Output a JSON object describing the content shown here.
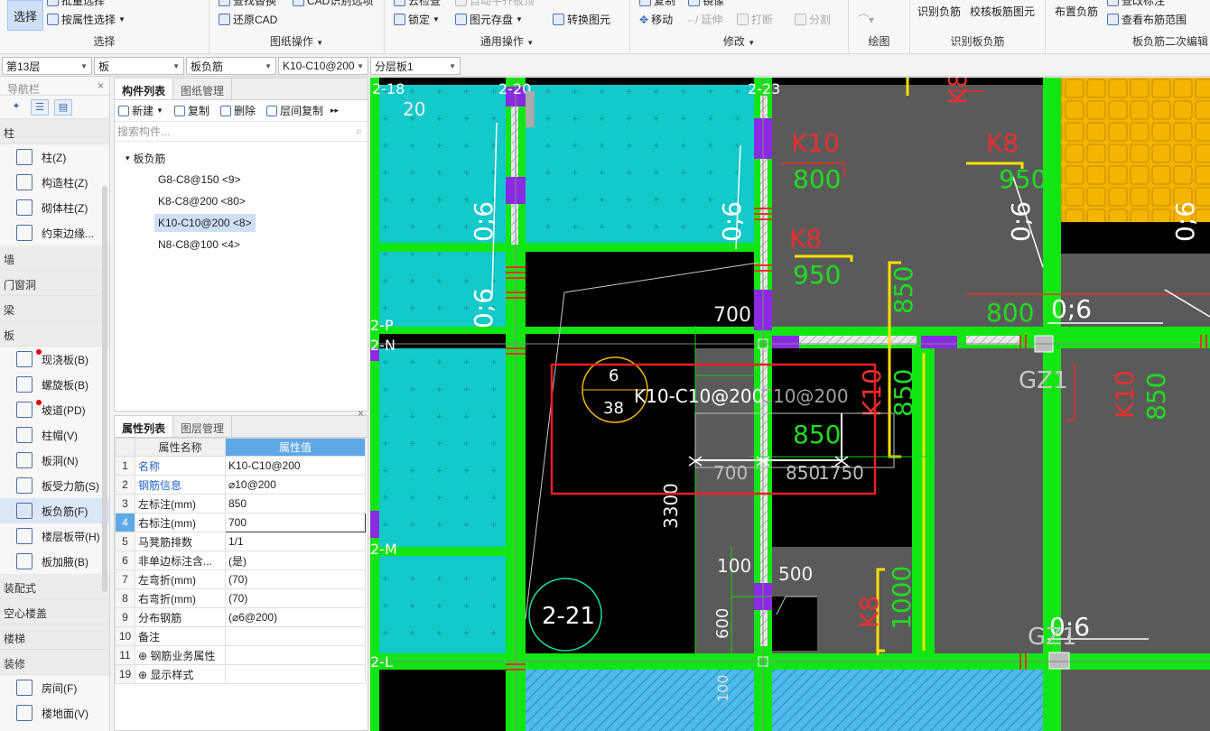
{
  "ribbon": {
    "select_button": "选择",
    "groups": [
      {
        "title": "选择",
        "items": [
          "批量选择",
          "按属性选择"
        ]
      },
      {
        "title": "图纸操作",
        "items": [
          "查找替换",
          "还原CAD",
          "CAD识别选项",
          "设置比例"
        ]
      },
      {
        "title": "通用操作",
        "items": [
          "锁定",
          "图元存盘",
          "转换图元",
          "云检查",
          "自动平齐板顶"
        ]
      },
      {
        "title": "修改",
        "items": [
          "移动",
          "延伸",
          "打断",
          "分割",
          "复制",
          "镜像"
        ]
      },
      {
        "title": "绘图",
        "items": []
      },
      {
        "title": "识别板负筋",
        "items": [
          "识别负筋",
          "校核板筋图元"
        ]
      },
      {
        "title": "板负筋二次编辑",
        "items": [
          "布置负筋",
          "查看布筋范围",
          "查改标注"
        ]
      }
    ]
  },
  "toolbar": {
    "floor": "第13层",
    "type": "板",
    "subtype": "板负筋",
    "component": "K10-C10@200",
    "layer": "分层板1"
  },
  "nav": {
    "title": "导航栏",
    "categories": [
      {
        "label": "柱",
        "items": [
          {
            "label": "柱(Z)",
            "icon": "column-icon",
            "dot": false
          },
          {
            "label": "构造柱(Z)",
            "icon": "constructional-column-icon",
            "dot": false
          },
          {
            "label": "砌体柱(Z)",
            "icon": "masonry-column-icon",
            "dot": false
          },
          {
            "label": "约束边缘...",
            "icon": "constraint-edge-icon",
            "dot": false
          }
        ]
      },
      {
        "label": "墙",
        "items": []
      },
      {
        "label": "门窗洞",
        "items": []
      },
      {
        "label": "梁",
        "items": []
      },
      {
        "label": "板",
        "items": [
          {
            "label": "现浇板(B)",
            "icon": "cast-slab-icon",
            "dot": true
          },
          {
            "label": "螺旋板(B)",
            "icon": "spiral-slab-icon",
            "dot": false
          },
          {
            "label": "坡道(PD)",
            "icon": "ramp-icon",
            "dot": true
          },
          {
            "label": "柱帽(V)",
            "icon": "column-cap-icon",
            "dot": false
          },
          {
            "label": "板洞(N)",
            "icon": "slab-hole-icon",
            "dot": false
          },
          {
            "label": "板受力筋(S)",
            "icon": "slab-rebar-icon",
            "dot": false
          },
          {
            "label": "板负筋(F)",
            "icon": "negative-rebar-icon",
            "dot": false,
            "selected": true
          },
          {
            "label": "楼层板带(H)",
            "icon": "slab-strip-icon",
            "dot": false
          },
          {
            "label": "板加腋(B)",
            "icon": "slab-haunch-icon",
            "dot": false
          }
        ]
      },
      {
        "label": "装配式",
        "items": []
      },
      {
        "label": "空心楼盖",
        "items": []
      },
      {
        "label": "楼梯",
        "items": []
      },
      {
        "label": "装修",
        "items": [
          {
            "label": "房间(F)",
            "icon": "room-icon",
            "dot": false
          },
          {
            "label": "楼地面(V)",
            "icon": "floor-icon",
            "dot": false
          }
        ]
      }
    ]
  },
  "components": {
    "tabs": [
      "构件列表",
      "图纸管理"
    ],
    "tools": [
      "新建",
      "复制",
      "删除",
      "层间复制"
    ],
    "search_placeholder": "搜索构件...",
    "root": "板负筋",
    "items": [
      {
        "label": "G8-C8@150 <9>"
      },
      {
        "label": "K8-C8@200 <80>"
      },
      {
        "label": "K10-C10@200 <8>",
        "selected": true
      },
      {
        "label": "N8-C8@100 <4>"
      }
    ]
  },
  "props": {
    "tabs": [
      "属性列表",
      "图层管理"
    ],
    "col_name": "属性名称",
    "col_value": "属性值",
    "rows": [
      {
        "n": "1",
        "name": "名称",
        "value": "K10-C10@200",
        "blue": true
      },
      {
        "n": "2",
        "name": "钢筋信息",
        "value": "⌀10@200",
        "blue": true
      },
      {
        "n": "3",
        "name": "左标注(mm)",
        "value": "850"
      },
      {
        "n": "4",
        "name": "右标注(mm)",
        "value": "700",
        "selected": true
      },
      {
        "n": "5",
        "name": "马凳筋排数",
        "value": "1/1"
      },
      {
        "n": "6",
        "name": "非单边标注含...",
        "value": "(是)"
      },
      {
        "n": "7",
        "name": "左弯折(mm)",
        "value": "(70)"
      },
      {
        "n": "8",
        "name": "右弯折(mm)",
        "value": "(70)"
      },
      {
        "n": "9",
        "name": "分布钢筋",
        "value": "(⌀6@200)"
      },
      {
        "n": "10",
        "name": "备注",
        "value": ""
      },
      {
        "n": "11",
        "name": "⊕ 钢筋业务属性",
        "value": ""
      },
      {
        "n": "19",
        "name": "⊕ 显示样式",
        "value": ""
      }
    ]
  },
  "cad": {
    "axis_labels": [
      "2-18",
      "2-20",
      "2-23",
      "2-P",
      "2-N",
      "2-M",
      "2-L"
    ],
    "bubble_top": "6",
    "bubble_bottom": "38",
    "bubble_axis": "2-21",
    "dims": [
      "700",
      "700",
      "850",
      "1750",
      "3300",
      "100",
      "500",
      "600",
      "100",
      "850",
      "850",
      "800",
      "800",
      "950",
      "950",
      "1000",
      "20"
    ],
    "rebar_labels": [
      "K10",
      "K8",
      "K8",
      "K8",
      "K8",
      "K10",
      "K10"
    ],
    "slab_labels": [
      "0;6",
      "0;6",
      "0;6",
      "0;6",
      "0;6",
      "0;6"
    ],
    "gz_labels": [
      "GZ1",
      "GZ1"
    ],
    "preview_text": "K10-C10@200",
    "ghost_text": "C10@200"
  }
}
